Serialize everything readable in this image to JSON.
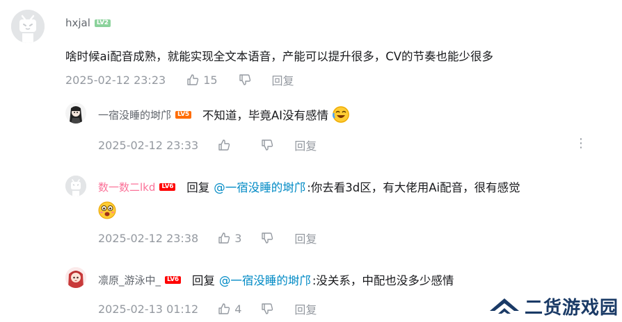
{
  "comment": {
    "username": "hxjal",
    "level": "LV2",
    "text": "啥时候ai配音成熟，就能实现全文本语音，产能可以提升很多，CV的节奏也能少很多",
    "time": "2025-02-12 23:23",
    "likes": "15",
    "reply_label": "回复"
  },
  "replies": [
    {
      "username": "一宿没睡的埘邝",
      "level": "LV5",
      "text": "不知道，毕竟AI没有感情",
      "time": "2025-02-12 23:33",
      "likes": "",
      "reply_label": "回复",
      "more_label": "⋮"
    },
    {
      "username": "数一数二lkd",
      "level": "LV6",
      "reply_prefix": "回复",
      "mention": "@一宿没睡的埘邝",
      "text": ":你去看3d区，有大佬用Ai配音，很有感觉",
      "time": "2025-02-12 23:38",
      "likes": "3",
      "reply_label": "回复"
    },
    {
      "username": "凛原_游泳中_",
      "level": "LV6",
      "reply_prefix": "回复",
      "mention": "@一宿没睡的埘邝",
      "text": ":没关系，中配也没多少感情",
      "time": "2025-02-13 01:12",
      "likes": "4",
      "reply_label": "回复"
    }
  ],
  "watermark": {
    "text": "二货游戏园"
  }
}
